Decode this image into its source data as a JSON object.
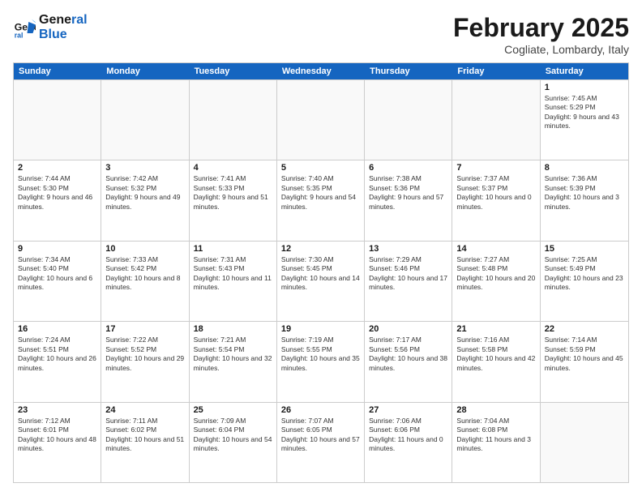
{
  "logo": {
    "line1": "General",
    "line2": "Blue"
  },
  "title": "February 2025",
  "location": "Cogliate, Lombardy, Italy",
  "days_of_week": [
    "Sunday",
    "Monday",
    "Tuesday",
    "Wednesday",
    "Thursday",
    "Friday",
    "Saturday"
  ],
  "weeks": [
    [
      {
        "day": "",
        "info": ""
      },
      {
        "day": "",
        "info": ""
      },
      {
        "day": "",
        "info": ""
      },
      {
        "day": "",
        "info": ""
      },
      {
        "day": "",
        "info": ""
      },
      {
        "day": "",
        "info": ""
      },
      {
        "day": "1",
        "info": "Sunrise: 7:45 AM\nSunset: 5:29 PM\nDaylight: 9 hours and 43 minutes."
      }
    ],
    [
      {
        "day": "2",
        "info": "Sunrise: 7:44 AM\nSunset: 5:30 PM\nDaylight: 9 hours and 46 minutes."
      },
      {
        "day": "3",
        "info": "Sunrise: 7:42 AM\nSunset: 5:32 PM\nDaylight: 9 hours and 49 minutes."
      },
      {
        "day": "4",
        "info": "Sunrise: 7:41 AM\nSunset: 5:33 PM\nDaylight: 9 hours and 51 minutes."
      },
      {
        "day": "5",
        "info": "Sunrise: 7:40 AM\nSunset: 5:35 PM\nDaylight: 9 hours and 54 minutes."
      },
      {
        "day": "6",
        "info": "Sunrise: 7:38 AM\nSunset: 5:36 PM\nDaylight: 9 hours and 57 minutes."
      },
      {
        "day": "7",
        "info": "Sunrise: 7:37 AM\nSunset: 5:37 PM\nDaylight: 10 hours and 0 minutes."
      },
      {
        "day": "8",
        "info": "Sunrise: 7:36 AM\nSunset: 5:39 PM\nDaylight: 10 hours and 3 minutes."
      }
    ],
    [
      {
        "day": "9",
        "info": "Sunrise: 7:34 AM\nSunset: 5:40 PM\nDaylight: 10 hours and 6 minutes."
      },
      {
        "day": "10",
        "info": "Sunrise: 7:33 AM\nSunset: 5:42 PM\nDaylight: 10 hours and 8 minutes."
      },
      {
        "day": "11",
        "info": "Sunrise: 7:31 AM\nSunset: 5:43 PM\nDaylight: 10 hours and 11 minutes."
      },
      {
        "day": "12",
        "info": "Sunrise: 7:30 AM\nSunset: 5:45 PM\nDaylight: 10 hours and 14 minutes."
      },
      {
        "day": "13",
        "info": "Sunrise: 7:29 AM\nSunset: 5:46 PM\nDaylight: 10 hours and 17 minutes."
      },
      {
        "day": "14",
        "info": "Sunrise: 7:27 AM\nSunset: 5:48 PM\nDaylight: 10 hours and 20 minutes."
      },
      {
        "day": "15",
        "info": "Sunrise: 7:25 AM\nSunset: 5:49 PM\nDaylight: 10 hours and 23 minutes."
      }
    ],
    [
      {
        "day": "16",
        "info": "Sunrise: 7:24 AM\nSunset: 5:51 PM\nDaylight: 10 hours and 26 minutes."
      },
      {
        "day": "17",
        "info": "Sunrise: 7:22 AM\nSunset: 5:52 PM\nDaylight: 10 hours and 29 minutes."
      },
      {
        "day": "18",
        "info": "Sunrise: 7:21 AM\nSunset: 5:54 PM\nDaylight: 10 hours and 32 minutes."
      },
      {
        "day": "19",
        "info": "Sunrise: 7:19 AM\nSunset: 5:55 PM\nDaylight: 10 hours and 35 minutes."
      },
      {
        "day": "20",
        "info": "Sunrise: 7:17 AM\nSunset: 5:56 PM\nDaylight: 10 hours and 38 minutes."
      },
      {
        "day": "21",
        "info": "Sunrise: 7:16 AM\nSunset: 5:58 PM\nDaylight: 10 hours and 42 minutes."
      },
      {
        "day": "22",
        "info": "Sunrise: 7:14 AM\nSunset: 5:59 PM\nDaylight: 10 hours and 45 minutes."
      }
    ],
    [
      {
        "day": "23",
        "info": "Sunrise: 7:12 AM\nSunset: 6:01 PM\nDaylight: 10 hours and 48 minutes."
      },
      {
        "day": "24",
        "info": "Sunrise: 7:11 AM\nSunset: 6:02 PM\nDaylight: 10 hours and 51 minutes."
      },
      {
        "day": "25",
        "info": "Sunrise: 7:09 AM\nSunset: 6:04 PM\nDaylight: 10 hours and 54 minutes."
      },
      {
        "day": "26",
        "info": "Sunrise: 7:07 AM\nSunset: 6:05 PM\nDaylight: 10 hours and 57 minutes."
      },
      {
        "day": "27",
        "info": "Sunrise: 7:06 AM\nSunset: 6:06 PM\nDaylight: 11 hours and 0 minutes."
      },
      {
        "day": "28",
        "info": "Sunrise: 7:04 AM\nSunset: 6:08 PM\nDaylight: 11 hours and 3 minutes."
      },
      {
        "day": "",
        "info": ""
      }
    ]
  ]
}
